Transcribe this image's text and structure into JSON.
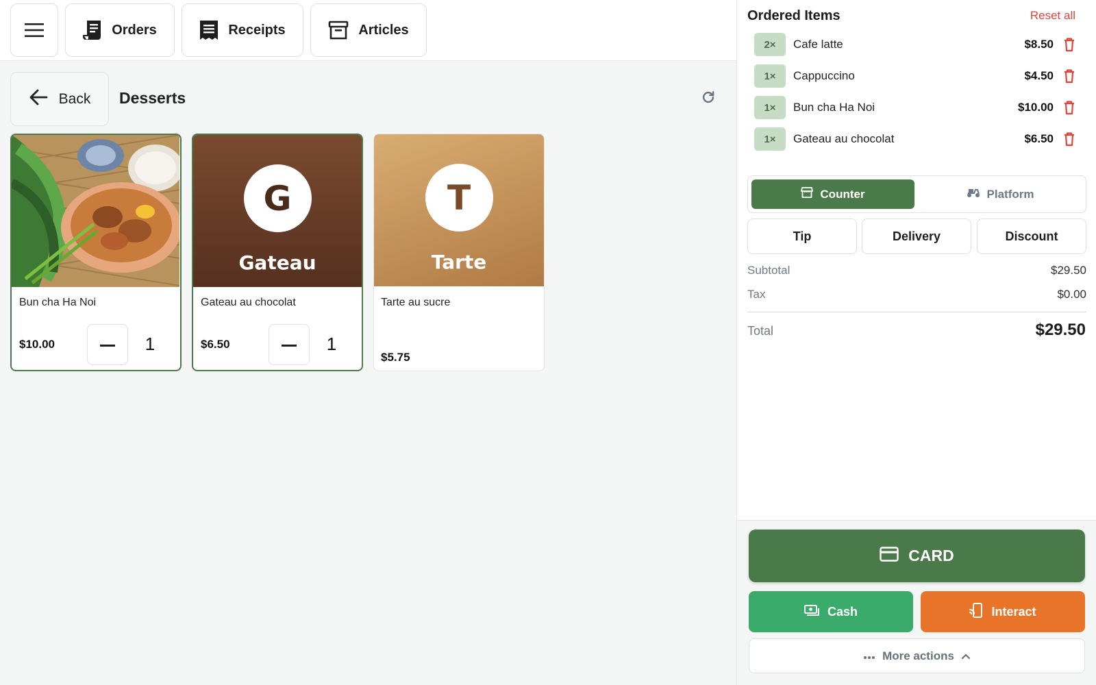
{
  "topbar": {
    "menu_icon": "hamburger-menu-icon",
    "tabs": [
      {
        "label": "Orders",
        "icon": "receipt-scroll-icon"
      },
      {
        "label": "Receipts",
        "icon": "receipt-list-icon"
      },
      {
        "label": "Articles",
        "icon": "archive-box-icon"
      }
    ]
  },
  "category": {
    "back_label": "Back",
    "title": "Desserts",
    "refresh_icon": "refresh-icon"
  },
  "products": [
    {
      "name": "Bun cha Ha Noi",
      "price": "$10.00",
      "qty": "1",
      "selected": true,
      "image": "photo"
    },
    {
      "name": "Gateau au chocolat",
      "price": "$6.50",
      "qty": "1",
      "selected": true,
      "letter": "G",
      "word": "Gateau",
      "color_top": "#7a4a30",
      "color_bottom": "#5a3322"
    },
    {
      "name": "Tarte au sucre",
      "price": "$5.75",
      "selected": false,
      "letter": "T",
      "word": "Tarte",
      "color_top": "#d4a66c",
      "color_bottom": "#b8824a"
    }
  ],
  "order": {
    "title": "Ordered Items",
    "reset_label": "Reset all",
    "items": [
      {
        "qty": "2×",
        "name": "Cafe latte",
        "price": "$8.50"
      },
      {
        "qty": "1×",
        "name": "Cappuccino",
        "price": "$4.50"
      },
      {
        "qty": "1×",
        "name": "Bun cha Ha Noi",
        "price": "$10.00"
      },
      {
        "qty": "1×",
        "name": "Gateau au chocolat",
        "price": "$6.50"
      }
    ],
    "mode": {
      "counter": "Counter",
      "platform": "Platform",
      "active": "Counter"
    },
    "options": {
      "tip": "Tip",
      "delivery": "Delivery",
      "discount": "Discount"
    },
    "subtotal_label": "Subtotal",
    "subtotal": "$29.50",
    "tax_label": "Tax",
    "tax": "$0.00",
    "total_label": "Total",
    "total": "$29.50"
  },
  "payment": {
    "card": "CARD",
    "cash": "Cash",
    "interact": "Interact",
    "more": "More actions"
  },
  "colors": {
    "accent_green": "#4a7a4a",
    "cash_green": "#3aab6a",
    "interact_orange": "#e8742a",
    "reset_red": "#e0453a",
    "qty_badge": "#c6dcc4"
  }
}
